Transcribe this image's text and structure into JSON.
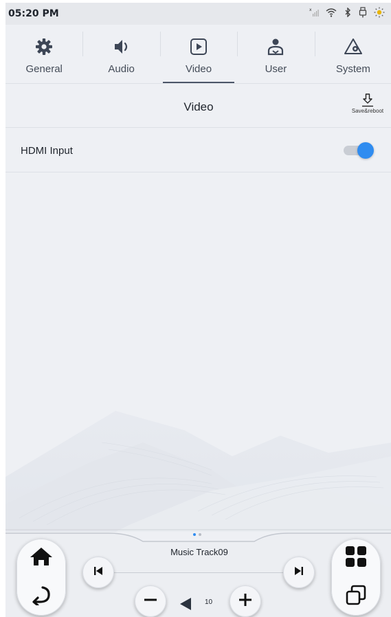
{
  "status_bar": {
    "time": "05:20 PM",
    "icons": [
      "signal-icon",
      "wifi-icon",
      "bluetooth-icon",
      "usb-icon",
      "brightness-icon"
    ]
  },
  "tabs": [
    {
      "label": "General",
      "icon": "gear-icon",
      "active": false
    },
    {
      "label": "Audio",
      "icon": "speaker-icon",
      "active": false
    },
    {
      "label": "Video",
      "icon": "play-icon",
      "active": true
    },
    {
      "label": "User",
      "icon": "user-icon",
      "active": false
    },
    {
      "label": "System",
      "icon": "system-icon",
      "active": false
    }
  ],
  "page": {
    "title": "Video",
    "save_label": "Save&reboot"
  },
  "settings": [
    {
      "label": "HDMI Input",
      "enabled": true
    }
  ],
  "player": {
    "track_title": "Music  Track09",
    "volume": "10"
  },
  "colors": {
    "accent": "#2f8cf0",
    "background": "#eef0f4",
    "text": "#1f242c"
  }
}
